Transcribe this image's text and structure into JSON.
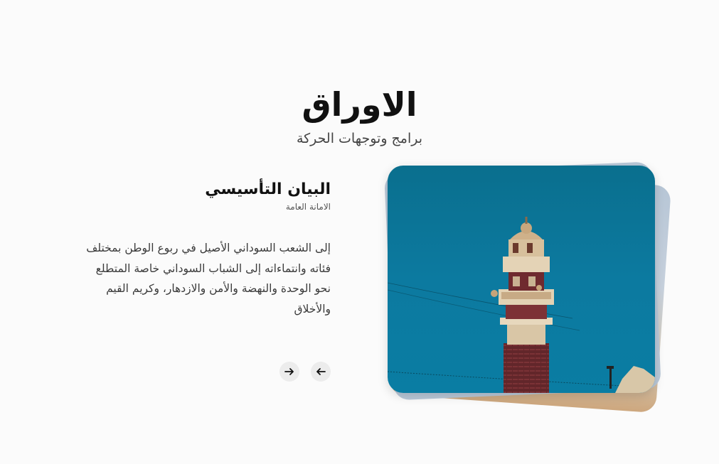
{
  "header": {
    "title": "الاوراق",
    "subtitle": "برامج وتوجهات الحركة"
  },
  "card": {
    "title": "البيان التأسيسي",
    "author": "الامانة العامة",
    "body": "إلى الشعب السوداني الأصيل في ربوع الوطن بمختلف فئاته وانتماءاته إلى الشباب السوداني خاصة المتطلع نحو الوحدة والنهضة والأمن والازدهار، وكريم القيم والأخلاق"
  },
  "navigation": {
    "next_icon": "arrow-right-icon",
    "prev_icon": "arrow-left-icon"
  },
  "colors": {
    "background": "#fbfbfb",
    "sky": "#0c7aa0",
    "button": "#ececec"
  }
}
